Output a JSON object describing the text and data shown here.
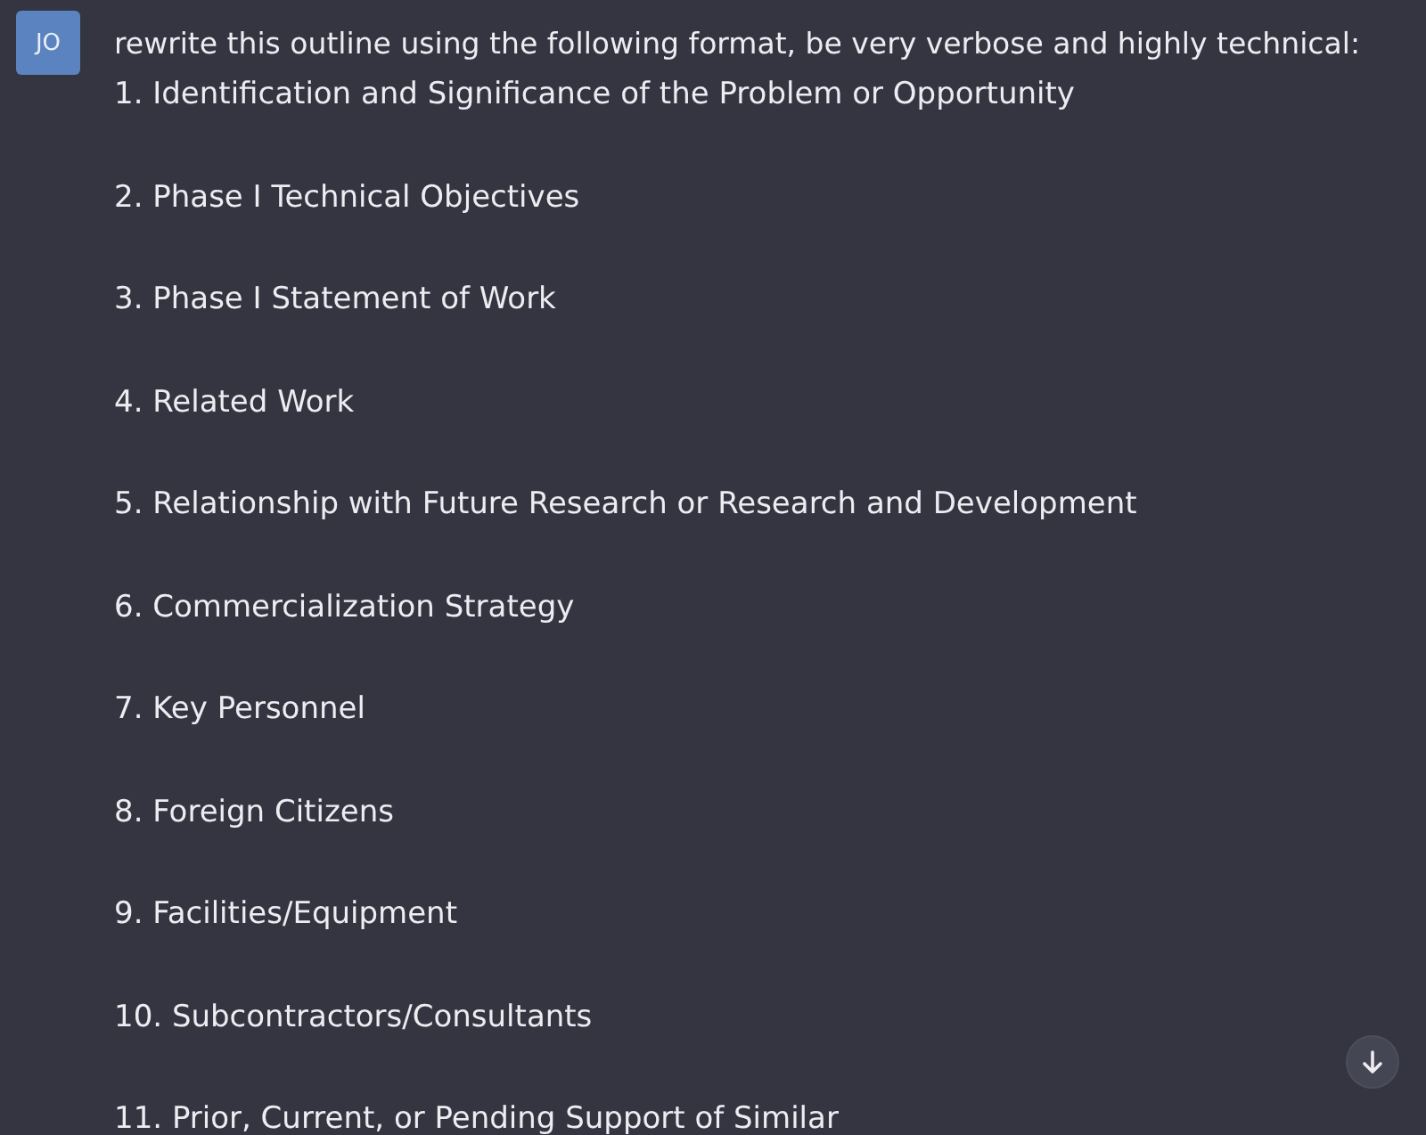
{
  "user": {
    "avatar": "JO",
    "prompt": "rewrite this outline using the following format, be very verbose and highly technical:"
  },
  "outline": [
    "1. Identification and Significance of the Problem or Opportunity",
    "2. Phase I Technical Objectives",
    "3. Phase I Statement of Work",
    "4. Related Work",
    "5. Relationship with Future Research or Research and Development",
    "6. Commercialization Strategy",
    "7. Key Personnel",
    "8. Foreign Citizens",
    "9. Facilities/Equipment",
    "10. Subcontractors/Consultants",
    "11. Prior, Current, or Pending Support of Similar"
  ]
}
